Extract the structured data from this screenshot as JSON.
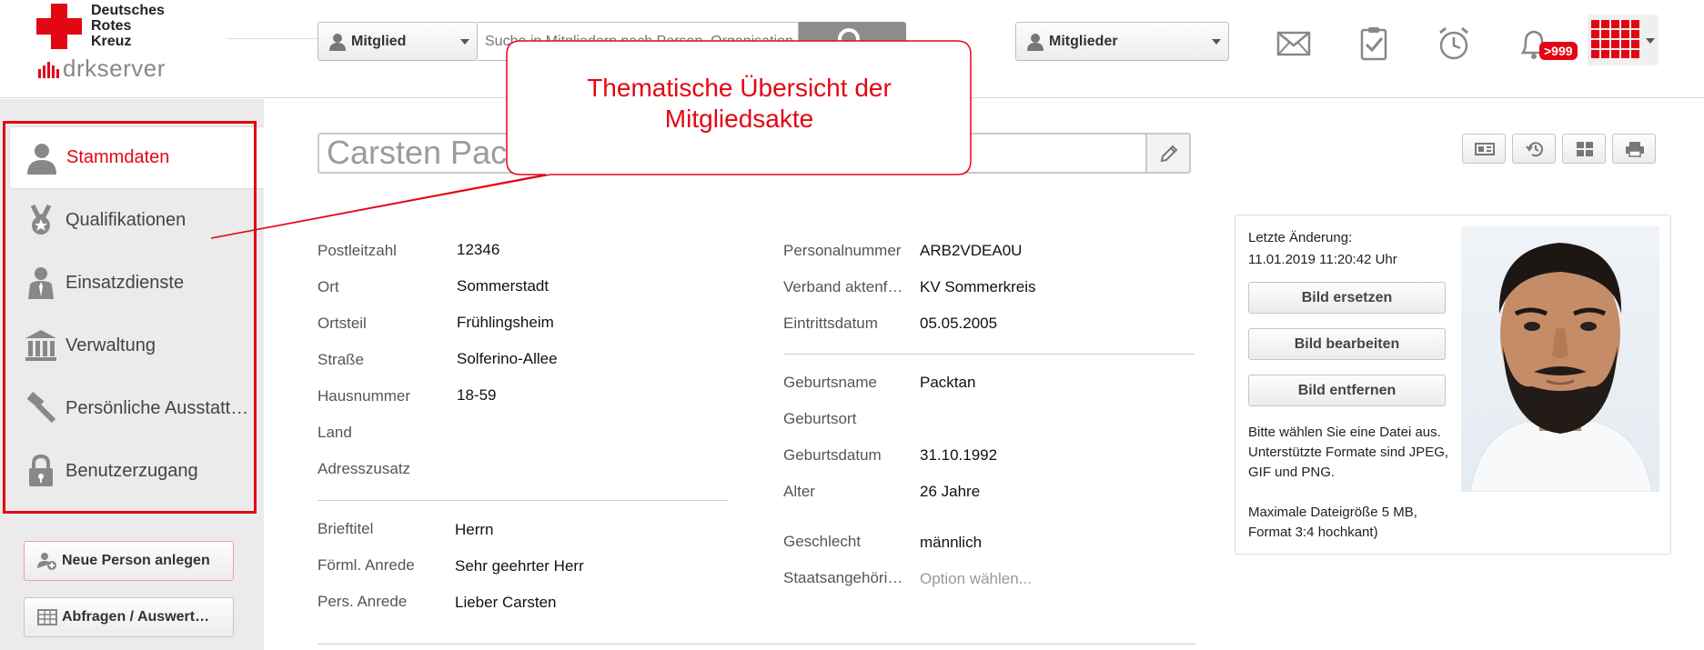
{
  "brand": {
    "org_name": "Deutsches\nRotes\nKreuz",
    "product": "drkserver",
    "accent": "#e30613"
  },
  "header": {
    "search_type": "Mitglied",
    "search_placeholder": "Suche in Mitgliedern nach Person, Organisation",
    "members_scope": "Mitglieder",
    "notification_count": ">999",
    "icons": [
      "mail-icon",
      "tasks-icon",
      "alarm-icon",
      "bell-icon",
      "apps-grid-icon"
    ]
  },
  "sidebar": {
    "items": [
      {
        "label": "Stammdaten",
        "icon": "person-icon",
        "active": true
      },
      {
        "label": "Qualifikationen",
        "icon": "medal-icon",
        "active": false
      },
      {
        "label": "Einsatzdienste",
        "icon": "uniform-person-icon",
        "active": false
      },
      {
        "label": "Verwaltung",
        "icon": "building-icon",
        "active": false
      },
      {
        "label": "Persönliche Ausstattung",
        "icon": "hammer-icon",
        "active": false
      },
      {
        "label": "Benutzerzugang",
        "icon": "lock-icon",
        "active": false
      }
    ],
    "new_person_label": "Neue Person anlegen",
    "queries_label": "Abfragen / Auswertungen"
  },
  "person": {
    "name": "Carsten Packtan"
  },
  "address": [
    {
      "label": "Postleitzahl",
      "value": "12346"
    },
    {
      "label": "Ort",
      "value": "Sommerstadt"
    },
    {
      "label": "Ortsteil",
      "value": "Frühlingsheim"
    },
    {
      "label": "Straße",
      "value": "Solferino-Allee"
    },
    {
      "label": "Hausnummer",
      "value": "18-59"
    },
    {
      "label": "Land",
      "value": ""
    },
    {
      "label": "Adresszusatz",
      "value": ""
    }
  ],
  "salutation": [
    {
      "label": "Brieftitel",
      "value": "Herrn"
    },
    {
      "label": "Förml. Anrede",
      "value": "Sehr geehrter Herr"
    },
    {
      "label": "Pers. Anrede",
      "value": "Lieber Carsten"
    }
  ],
  "membership": [
    {
      "label": "Personalnummer",
      "value": "ARB2VDEA0U"
    },
    {
      "label": "Verband aktenführend",
      "value": "KV Sommerkreis"
    },
    {
      "label": "Eintrittsdatum",
      "value": "05.05.2005"
    }
  ],
  "birth": [
    {
      "label": "Geburtsname",
      "value": "Packtan"
    },
    {
      "label": "Geburtsort",
      "value": ""
    },
    {
      "label": "Geburtsdatum",
      "value": "31.10.1992"
    },
    {
      "label": "Alter",
      "value": "26 Jahre"
    },
    {
      "label": "Geschlecht",
      "value": "männlich"
    },
    {
      "label": "Staatsangehörigkeit",
      "value": "Option wählen..."
    }
  ],
  "photo_panel": {
    "last_change_label": "Letzte Änderung:",
    "last_change_value": "11.01.2019 11:20:42 Uhr",
    "replace_label": "Bild ersetzen",
    "edit_label": "Bild bearbeiten",
    "remove_label": "Bild entfernen",
    "hint": "Bitte wählen Sie eine Datei aus. Unterstützte Formate sind JPEG, GIF und PNG.\n\nMaximale Dateigröße 5 MB, Format 3:4 hochkant)"
  },
  "callout": {
    "text": "Thematische Übersicht der Mitgliedsakte"
  }
}
